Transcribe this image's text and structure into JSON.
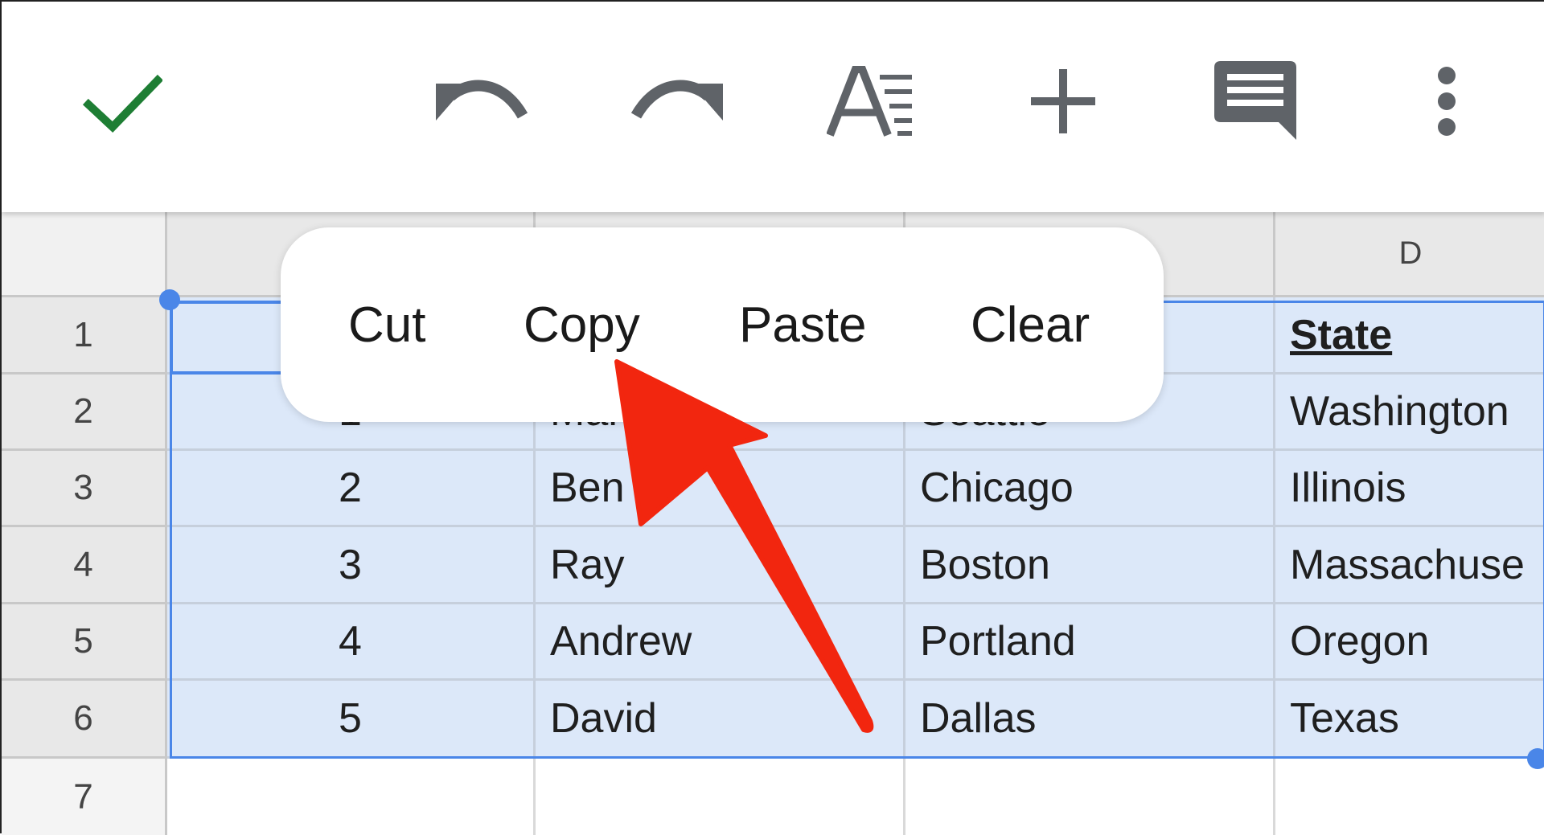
{
  "toolbar": {
    "icons": [
      "check-icon",
      "undo-icon",
      "redo-icon",
      "text-format-icon",
      "insert-icon",
      "comment-icon",
      "more-vert-icon"
    ],
    "check_color": "#1e7e34",
    "icon_color": "#5f6368"
  },
  "columns": [
    "",
    "",
    "",
    "D"
  ],
  "rows": [
    "1",
    "2",
    "3",
    "4",
    "5",
    "6",
    "7"
  ],
  "cells": {
    "r1": {
      "a": "",
      "b": "",
      "c": "",
      "d": "State"
    },
    "r2": {
      "a": "1",
      "b": "Mar",
      "c": "Seattle",
      "d": "Washington"
    },
    "r3": {
      "a": "2",
      "b": "Ben",
      "c": "Chicago",
      "d": "Illinois"
    },
    "r4": {
      "a": "3",
      "b": "Ray",
      "c": "Boston",
      "d": "Massachuse"
    },
    "r5": {
      "a": "4",
      "b": "Andrew",
      "c": "Portland",
      "d": "Oregon"
    },
    "r6": {
      "a": "5",
      "b": "David",
      "c": "Dallas",
      "d": "Texas"
    }
  },
  "context_menu": {
    "cut": "Cut",
    "copy": "Copy",
    "paste": "Paste",
    "clear": "Clear"
  },
  "colors": {
    "selection": "#4a86e8",
    "selection_fill": "#dce8f9",
    "arrow": "#f2260f"
  }
}
